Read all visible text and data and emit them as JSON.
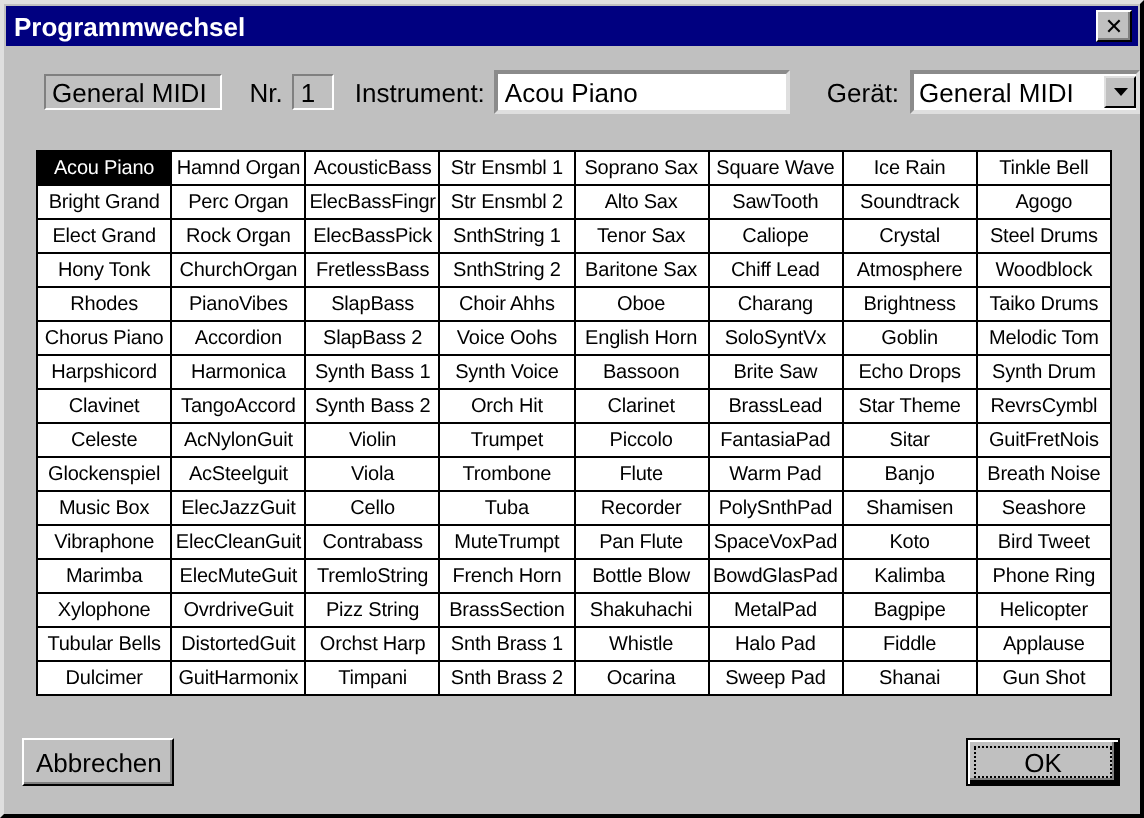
{
  "window": {
    "title": "Programmwechsel",
    "close": "✕"
  },
  "header": {
    "bank": "General MIDI",
    "number_label": "Nr.",
    "number": "1",
    "instrument_label": "Instrument:",
    "instrument": "Acou Piano",
    "device_label": "Gerät:",
    "device": "General MIDI"
  },
  "grid": {
    "columns": [
      [
        {
          "label": "Acou Piano",
          "selected": true
        },
        {
          "label": "Bright Grand",
          "selected": false
        },
        {
          "label": "Elect Grand",
          "selected": false
        },
        {
          "label": "Hony Tonk",
          "selected": false
        },
        {
          "label": "Rhodes",
          "selected": false
        },
        {
          "label": "Chorus Piano",
          "selected": false
        },
        {
          "label": "Harpshicord",
          "selected": false
        },
        {
          "label": "Clavinet",
          "selected": false
        },
        {
          "label": "Celeste",
          "selected": false
        },
        {
          "label": "Glockenspiel",
          "selected": false
        },
        {
          "label": "Music Box",
          "selected": false
        },
        {
          "label": "Vibraphone",
          "selected": false
        },
        {
          "label": "Marimba",
          "selected": false
        },
        {
          "label": "Xylophone",
          "selected": false
        },
        {
          "label": "Tubular Bells",
          "selected": false
        },
        {
          "label": "Dulcimer",
          "selected": false
        }
      ],
      [
        {
          "label": "Hamnd Organ",
          "selected": false
        },
        {
          "label": "Perc Organ",
          "selected": false
        },
        {
          "label": "Rock Organ",
          "selected": false
        },
        {
          "label": "ChurchOrgan",
          "selected": false
        },
        {
          "label": "PianoVibes",
          "selected": false
        },
        {
          "label": "Accordion",
          "selected": false
        },
        {
          "label": "Harmonica",
          "selected": false
        },
        {
          "label": "TangoAccord",
          "selected": false
        },
        {
          "label": "AcNylonGuit",
          "selected": false
        },
        {
          "label": "AcSteelguit",
          "selected": false
        },
        {
          "label": "ElecJazzGuit",
          "selected": false
        },
        {
          "label": "ElecCleanGuit",
          "selected": false
        },
        {
          "label": "ElecMuteGuit",
          "selected": false
        },
        {
          "label": "OvrdriveGuit",
          "selected": false
        },
        {
          "label": "DistortedGuit",
          "selected": false
        },
        {
          "label": "GuitHarmonix",
          "selected": false
        }
      ],
      [
        {
          "label": "AcousticBass",
          "selected": false
        },
        {
          "label": "ElecBassFingr",
          "selected": false
        },
        {
          "label": "ElecBassPick",
          "selected": false
        },
        {
          "label": "FretlessBass",
          "selected": false
        },
        {
          "label": "SlapBass",
          "selected": false
        },
        {
          "label": "SlapBass 2",
          "selected": false
        },
        {
          "label": "Synth Bass 1",
          "selected": false
        },
        {
          "label": "Synth Bass 2",
          "selected": false
        },
        {
          "label": "Violin",
          "selected": false
        },
        {
          "label": "Viola",
          "selected": false
        },
        {
          "label": "Cello",
          "selected": false
        },
        {
          "label": "Contrabass",
          "selected": false
        },
        {
          "label": "TremloString",
          "selected": false
        },
        {
          "label": "Pizz String",
          "selected": false
        },
        {
          "label": "Orchst Harp",
          "selected": false
        },
        {
          "label": "Timpani",
          "selected": false
        }
      ],
      [
        {
          "label": "Str Ensmbl 1",
          "selected": false
        },
        {
          "label": "Str Ensmbl 2",
          "selected": false
        },
        {
          "label": "SnthString 1",
          "selected": false
        },
        {
          "label": "SnthString 2",
          "selected": false
        },
        {
          "label": "Choir Ahhs",
          "selected": false
        },
        {
          "label": "Voice Oohs",
          "selected": false
        },
        {
          "label": "Synth Voice",
          "selected": false
        },
        {
          "label": "Orch Hit",
          "selected": false
        },
        {
          "label": "Trumpet",
          "selected": false
        },
        {
          "label": "Trombone",
          "selected": false
        },
        {
          "label": "Tuba",
          "selected": false
        },
        {
          "label": "MuteTrumpt",
          "selected": false
        },
        {
          "label": "French Horn",
          "selected": false
        },
        {
          "label": "BrassSection",
          "selected": false
        },
        {
          "label": "Snth Brass 1",
          "selected": false
        },
        {
          "label": "Snth Brass 2",
          "selected": false
        }
      ],
      [
        {
          "label": "Soprano Sax",
          "selected": false
        },
        {
          "label": "Alto Sax",
          "selected": false
        },
        {
          "label": "Tenor Sax",
          "selected": false
        },
        {
          "label": "Baritone Sax",
          "selected": false
        },
        {
          "label": "Oboe",
          "selected": false
        },
        {
          "label": "English Horn",
          "selected": false
        },
        {
          "label": "Bassoon",
          "selected": false
        },
        {
          "label": "Clarinet",
          "selected": false
        },
        {
          "label": "Piccolo",
          "selected": false
        },
        {
          "label": "Flute",
          "selected": false
        },
        {
          "label": "Recorder",
          "selected": false
        },
        {
          "label": "Pan Flute",
          "selected": false
        },
        {
          "label": "Bottle Blow",
          "selected": false
        },
        {
          "label": "Shakuhachi",
          "selected": false
        },
        {
          "label": "Whistle",
          "selected": false
        },
        {
          "label": "Ocarina",
          "selected": false
        }
      ],
      [
        {
          "label": "Square Wave",
          "selected": false
        },
        {
          "label": "SawTooth",
          "selected": false
        },
        {
          "label": "Caliope",
          "selected": false
        },
        {
          "label": "Chiff Lead",
          "selected": false
        },
        {
          "label": "Charang",
          "selected": false
        },
        {
          "label": "SoloSyntVx",
          "selected": false
        },
        {
          "label": "Brite Saw",
          "selected": false
        },
        {
          "label": "BrassLead",
          "selected": false
        },
        {
          "label": "FantasiaPad",
          "selected": false
        },
        {
          "label": "Warm Pad",
          "selected": false
        },
        {
          "label": "PolySnthPad",
          "selected": false
        },
        {
          "label": "SpaceVoxPad",
          "selected": false
        },
        {
          "label": "BowdGlasPad",
          "selected": false
        },
        {
          "label": "MetalPad",
          "selected": false
        },
        {
          "label": "Halo Pad",
          "selected": false
        },
        {
          "label": "Sweep Pad",
          "selected": false
        }
      ],
      [
        {
          "label": "Ice Rain",
          "selected": false
        },
        {
          "label": "Soundtrack",
          "selected": false
        },
        {
          "label": "Crystal",
          "selected": false
        },
        {
          "label": "Atmosphere",
          "selected": false
        },
        {
          "label": "Brightness",
          "selected": false
        },
        {
          "label": "Goblin",
          "selected": false
        },
        {
          "label": "Echo Drops",
          "selected": false
        },
        {
          "label": "Star Theme",
          "selected": false
        },
        {
          "label": "Sitar",
          "selected": false
        },
        {
          "label": "Banjo",
          "selected": false
        },
        {
          "label": "Shamisen",
          "selected": false
        },
        {
          "label": "Koto",
          "selected": false
        },
        {
          "label": "Kalimba",
          "selected": false
        },
        {
          "label": "Bagpipe",
          "selected": false
        },
        {
          "label": "Fiddle",
          "selected": false
        },
        {
          "label": "Shanai",
          "selected": false
        }
      ],
      [
        {
          "label": "Tinkle Bell",
          "selected": false
        },
        {
          "label": "Agogo",
          "selected": false
        },
        {
          "label": "Steel Drums",
          "selected": false
        },
        {
          "label": "Woodblock",
          "selected": false
        },
        {
          "label": "Taiko Drums",
          "selected": false
        },
        {
          "label": "Melodic Tom",
          "selected": false
        },
        {
          "label": "Synth Drum",
          "selected": false
        },
        {
          "label": "RevrsCymbl",
          "selected": false
        },
        {
          "label": "GuitFretNois",
          "selected": false
        },
        {
          "label": "Breath Noise",
          "selected": false
        },
        {
          "label": "Seashore",
          "selected": false
        },
        {
          "label": "Bird Tweet",
          "selected": false
        },
        {
          "label": "Phone Ring",
          "selected": false
        },
        {
          "label": "Helicopter",
          "selected": false
        },
        {
          "label": "Applause",
          "selected": false
        },
        {
          "label": "Gun Shot",
          "selected": false
        }
      ]
    ]
  },
  "buttons": [
    {
      "label": "Abbrechen",
      "default": false
    },
    {
      "label": "OK",
      "default": true
    }
  ]
}
